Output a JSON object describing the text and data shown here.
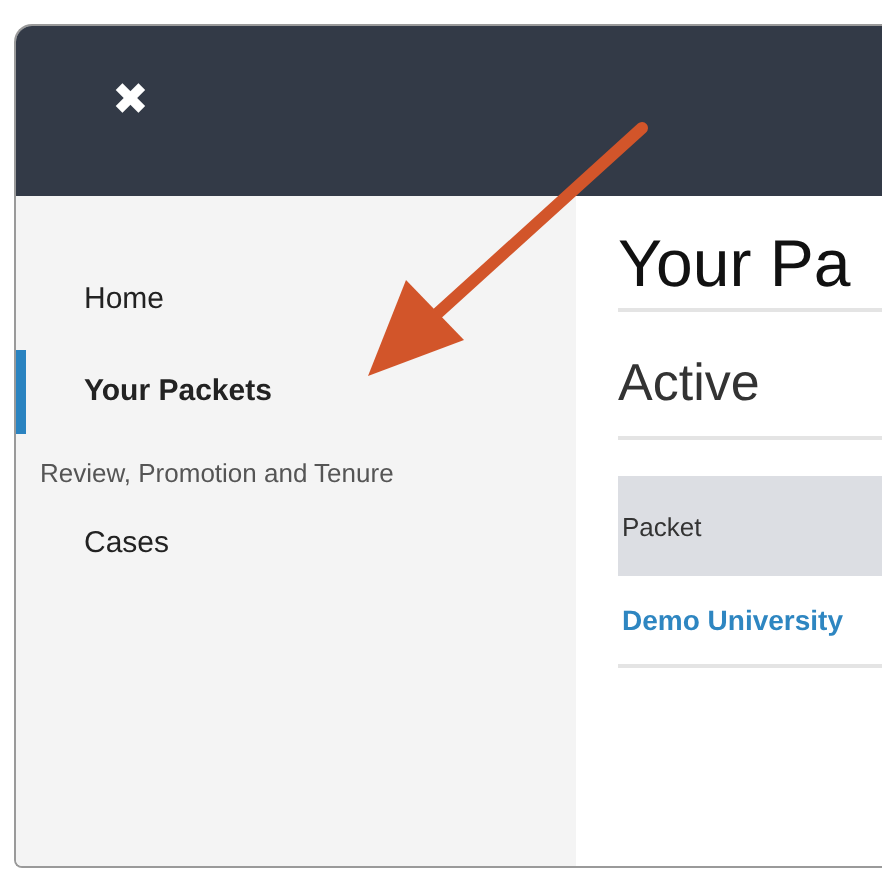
{
  "header": {
    "close_icon": "✖"
  },
  "sidebar": {
    "items": [
      {
        "label": "Home",
        "kind": "link",
        "selected": false
      },
      {
        "label": "Your Packets",
        "kind": "link",
        "selected": true
      },
      {
        "label": "Review, Promotion and Tenure",
        "kind": "section"
      },
      {
        "label": "Cases",
        "kind": "link",
        "selected": false
      }
    ]
  },
  "main": {
    "title": "Your Pa",
    "section": "Active",
    "table": {
      "columns": [
        "Packet"
      ],
      "rows": [
        [
          "Demo University"
        ]
      ]
    }
  }
}
